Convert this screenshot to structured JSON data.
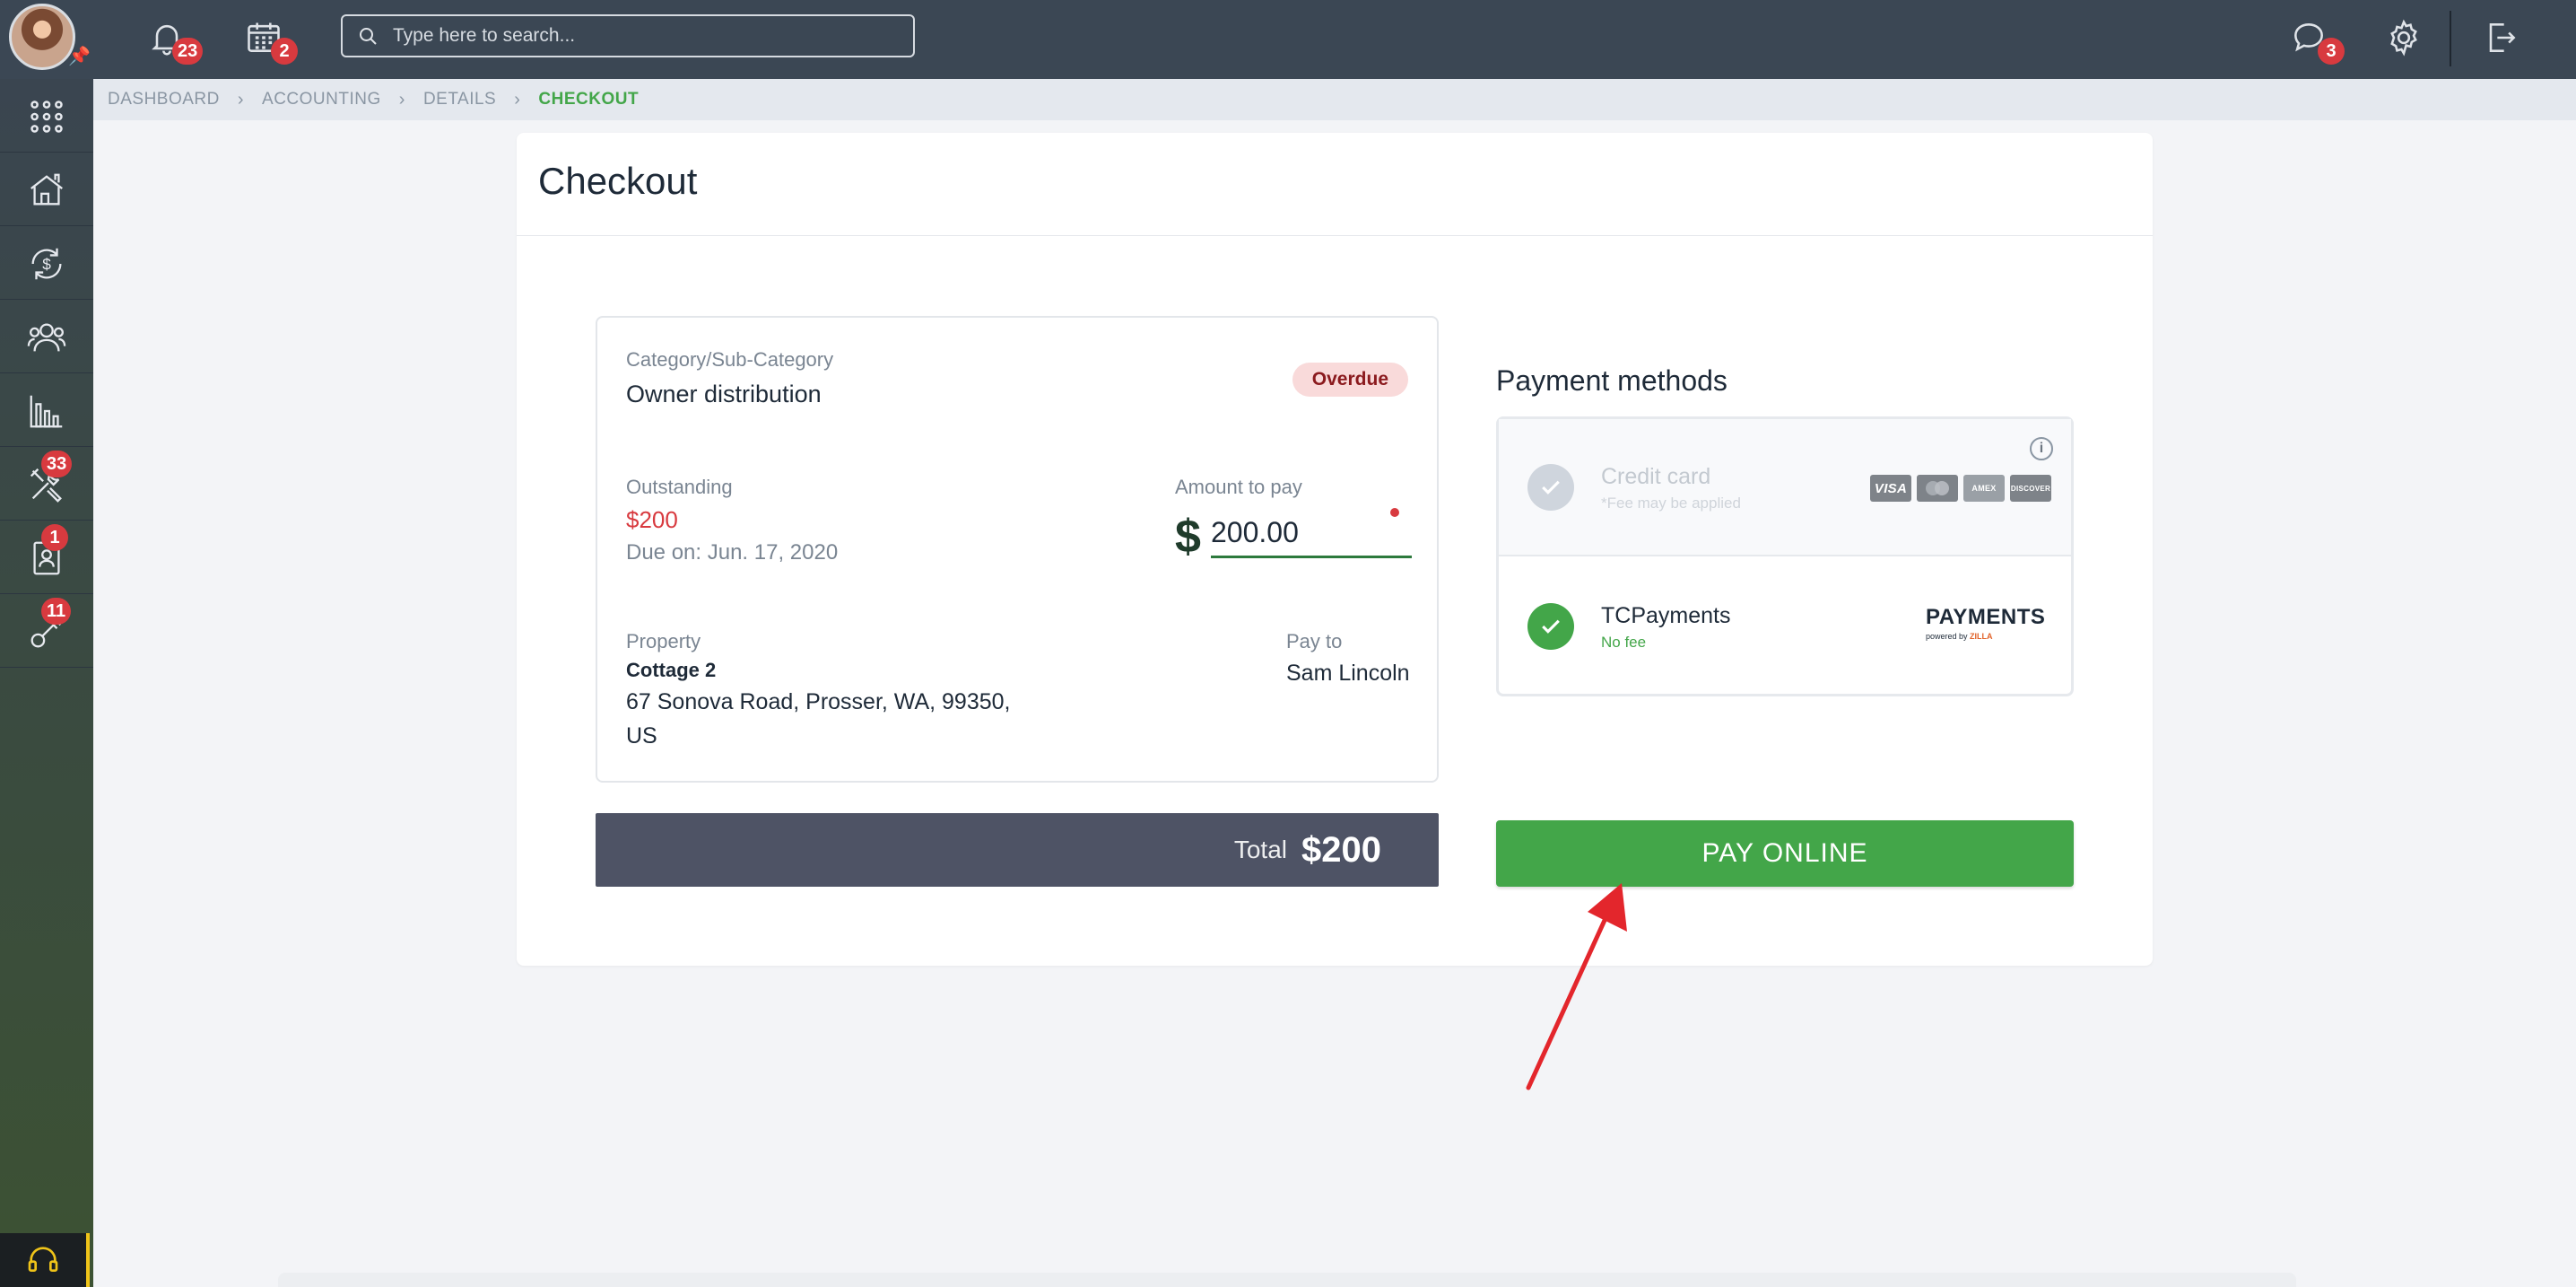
{
  "topbar": {
    "notifications_count": "23",
    "calendar_count": "2",
    "search_placeholder": "Type here to search...",
    "messages_count": "3"
  },
  "sidebar": {
    "items": [
      {
        "icon": "apps-grid-icon",
        "badge": ""
      },
      {
        "icon": "house-icon",
        "badge": ""
      },
      {
        "icon": "money-cycle-icon",
        "badge": ""
      },
      {
        "icon": "people-icon",
        "badge": ""
      },
      {
        "icon": "bar-chart-icon",
        "badge": ""
      },
      {
        "icon": "tools-icon",
        "badge": "33"
      },
      {
        "icon": "contact-card-icon",
        "badge": "1"
      },
      {
        "icon": "key-icon",
        "badge": "11"
      }
    ]
  },
  "breadcrumb": [
    "DASHBOARD",
    "ACCOUNTING",
    "DETAILS",
    "CHECKOUT"
  ],
  "page": {
    "title": "Checkout"
  },
  "details": {
    "category_label": "Category/Sub-Category",
    "category_value": "Owner distribution",
    "status": "Overdue",
    "outstanding_label": "Outstanding",
    "outstanding_value": "$200",
    "due_on": "Due on: Jun. 17, 2020",
    "amount_label": "Amount to pay",
    "currency_symbol": "$",
    "amount_value": "200.00",
    "property_label": "Property",
    "property_name": "Cottage 2",
    "property_address_line1": "67 Sonova Road, Prosser, WA, 99350,",
    "property_address_line2": "US",
    "pay_to_label": "Pay to",
    "pay_to_value": "Sam Lincoln"
  },
  "total": {
    "label": "Total",
    "value": "$200"
  },
  "payment_methods": {
    "title": "Payment methods",
    "credit_card": {
      "name": "Credit card",
      "note": "*Fee may be applied",
      "logos": [
        "VISA",
        "MasterCard",
        "AMEX",
        "DISCOVER"
      ]
    },
    "tcpayments": {
      "name": "TCPayments",
      "note": "No fee",
      "logo_word": "PAYMENTS",
      "logo_sub_prefix": "powered by",
      "logo_sub_brand": "ZILLA"
    }
  },
  "pay_button": "PAY ONLINE",
  "colors": {
    "topbar": "#3b4754",
    "accent_green": "#43a649",
    "overdue_bg": "#f9dada",
    "danger_red": "#d83a3f",
    "total_bar": "#4e5365",
    "annotation_arrow": "#e3262c"
  }
}
